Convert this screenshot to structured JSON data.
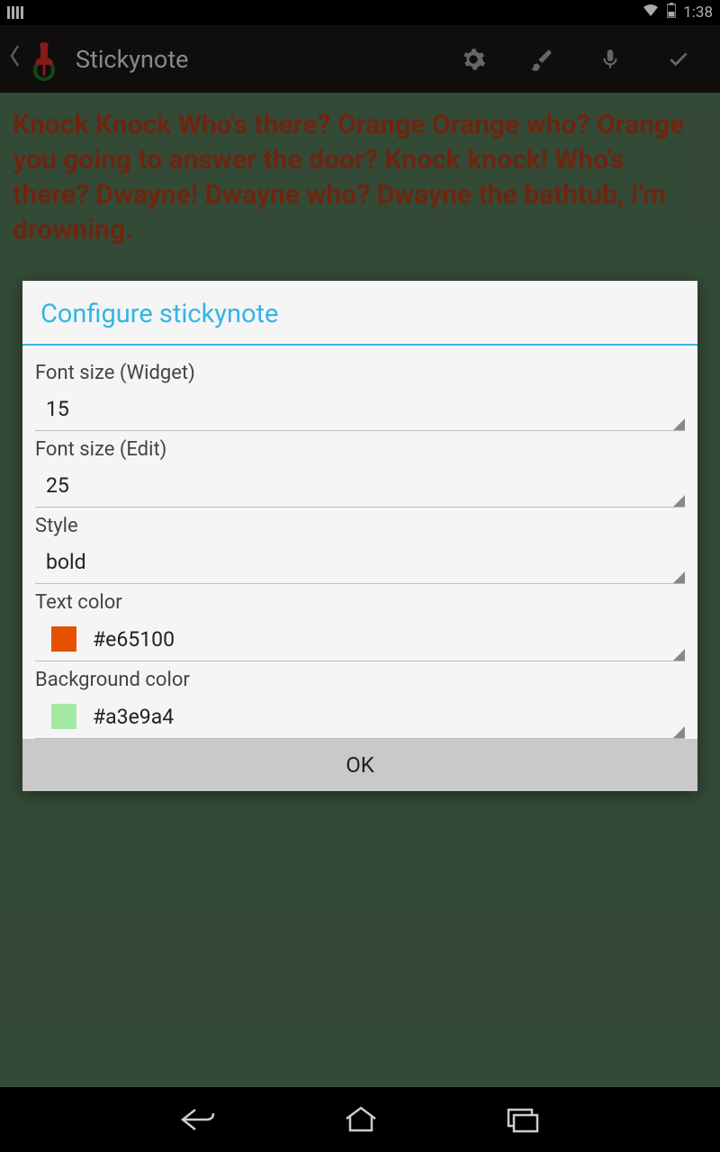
{
  "status": {
    "time": "1:38"
  },
  "header": {
    "title": "Stickynote"
  },
  "note": {
    "text": "Knock Knock Who's there? Orange Orange who? Orange you going to answer the door? Knock knock! Who's there? Dwayne! Dwayne who? Dwayne the bathtub, I'm drowning."
  },
  "dialog": {
    "title": "Configure stickynote",
    "fields": {
      "font_widget": {
        "label": "Font size (Widget)",
        "value": "15"
      },
      "font_edit": {
        "label": "Font size (Edit)",
        "value": "25"
      },
      "style": {
        "label": "Style",
        "value": "bold"
      },
      "text_color": {
        "label": "Text color",
        "value": "#e65100",
        "swatch": "#e65100"
      },
      "bg_color": {
        "label": "Background color",
        "value": "#a3e9a4",
        "swatch": "#a3e9a4"
      }
    },
    "ok": "OK"
  }
}
